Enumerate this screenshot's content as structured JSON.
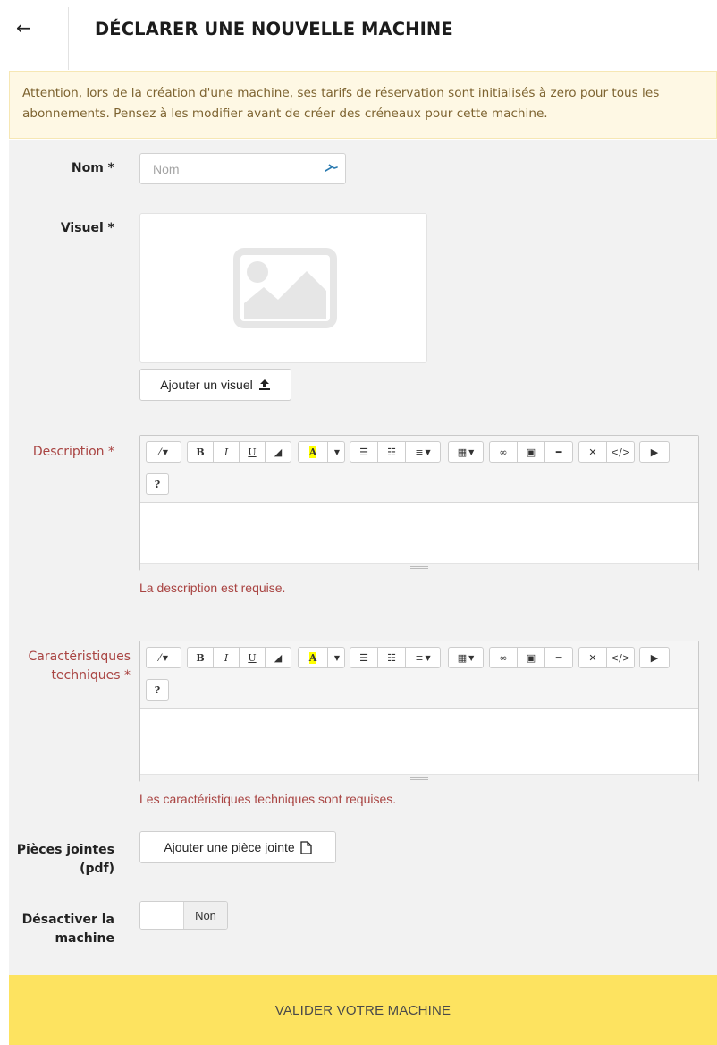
{
  "header": {
    "back_icon": "←",
    "title": "DÉCLARER UNE NOUVELLE MACHINE"
  },
  "alert": {
    "text": "Attention, lors de la création d'une machine, ses tarifs de réservation sont initialisés à zero pour tous les abonnements. Pensez à les modifier avant de créer des créneaux pour cette machine."
  },
  "form": {
    "name": {
      "label": "Nom *",
      "placeholder": "Nom",
      "value": ""
    },
    "visual": {
      "label": "Visuel *",
      "button_label": "Ajouter un visuel"
    },
    "description": {
      "label": "Description *",
      "error": "La description est requise."
    },
    "specs": {
      "label_line1": "Caractéristiques",
      "label_line2": "techniques *",
      "error": "Les caractéristiques techniques sont requises."
    },
    "attachments": {
      "label_line1": "Pièces jointes",
      "label_line2": "(pdf)",
      "button_label": "Ajouter une pièce jointe"
    },
    "disable": {
      "label_line1": "Désactiver la",
      "label_line2": "machine",
      "toggle_state": "Non"
    }
  },
  "toolbar": {
    "buttons": [
      "style",
      "bold",
      "italic",
      "underline",
      "eraser",
      "highlight-color",
      "ordered-list",
      "unordered-list",
      "paragraph-align",
      "table",
      "link",
      "picture",
      "horizontal-rule",
      "fullscreen",
      "code-view",
      "video",
      "help"
    ],
    "bold": "B",
    "italic": "I",
    "underline": "U",
    "color": "A",
    "help": "?"
  },
  "submit": {
    "label": "VALIDER VOTRE MACHINE"
  },
  "colors": {
    "alert_bg": "#fef8e4",
    "error": "#a94442",
    "submit_bg": "#fde360",
    "panel_bg": "#f2f2f2"
  }
}
